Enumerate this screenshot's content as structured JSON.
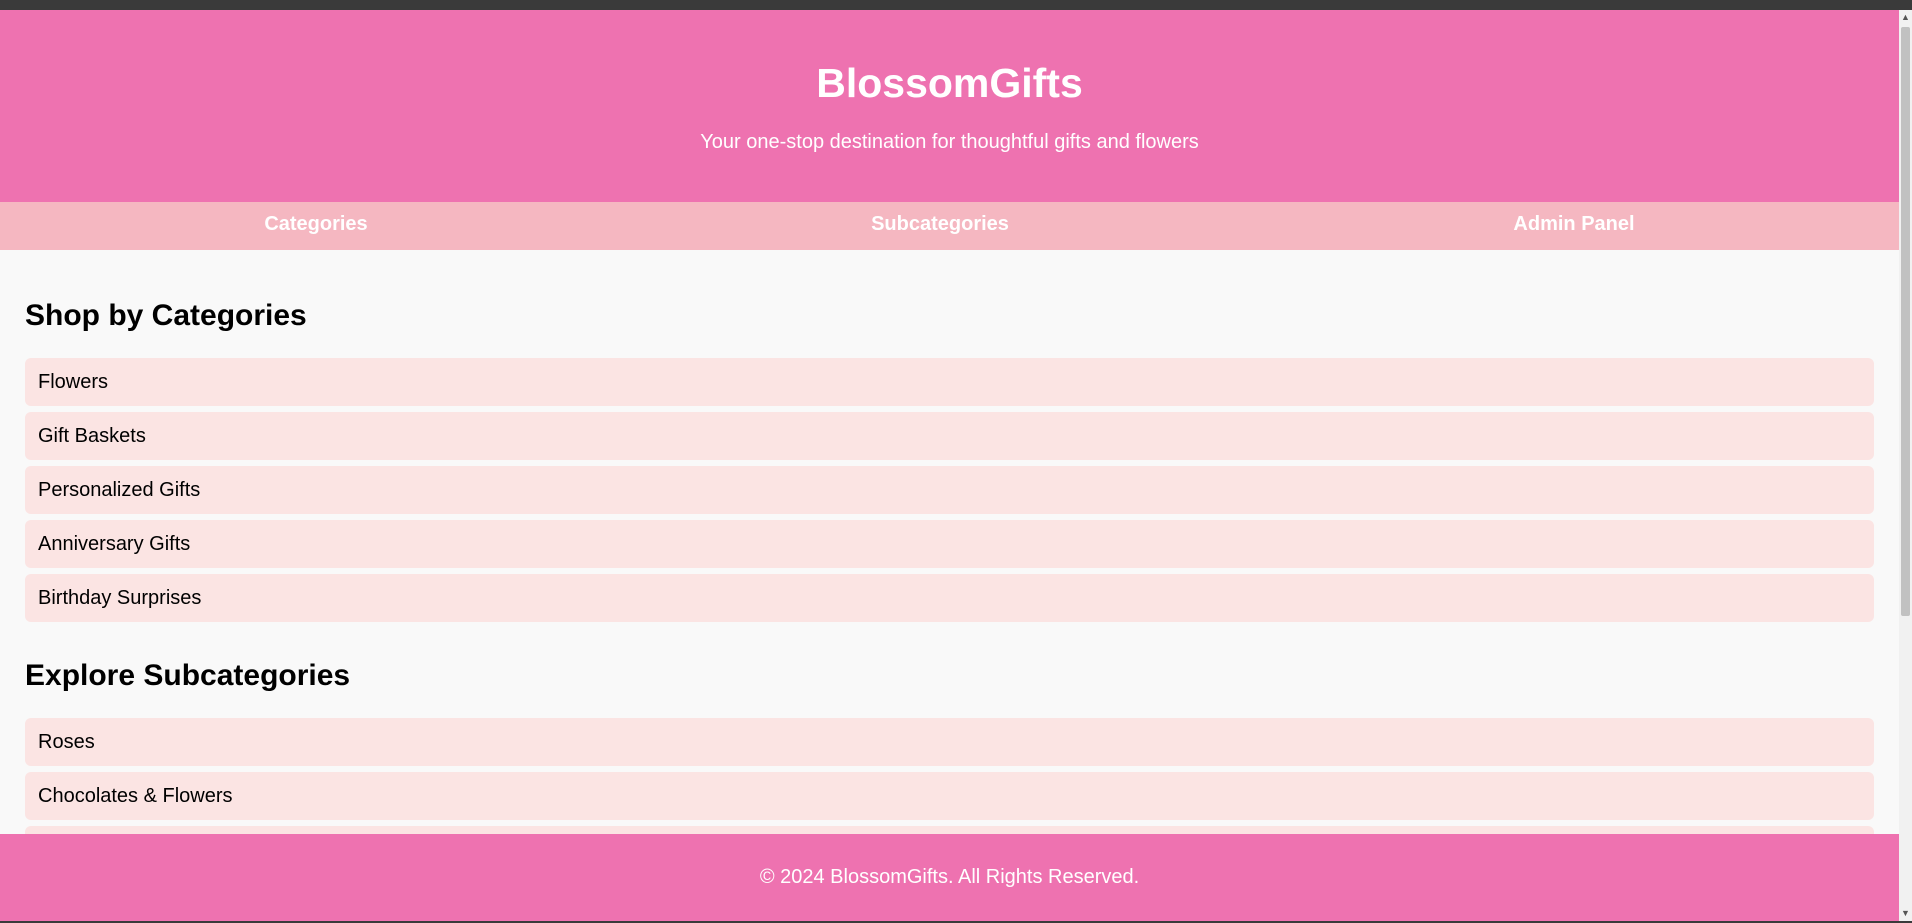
{
  "header": {
    "title": "BlossomGifts",
    "tagline": "Your one-stop destination for thoughtful gifts and flowers"
  },
  "nav": {
    "items": [
      {
        "label": "Categories"
      },
      {
        "label": "Subcategories"
      },
      {
        "label": "Admin Panel"
      }
    ]
  },
  "categories": {
    "heading": "Shop by Categories",
    "items": [
      {
        "label": "Flowers"
      },
      {
        "label": "Gift Baskets"
      },
      {
        "label": "Personalized Gifts"
      },
      {
        "label": "Anniversary Gifts"
      },
      {
        "label": "Birthday Surprises"
      }
    ]
  },
  "subcategories": {
    "heading": "Explore Subcategories",
    "items": [
      {
        "label": "Roses"
      },
      {
        "label": "Chocolates & Flowers"
      },
      {
        "label": ""
      }
    ]
  },
  "footer": {
    "text": "© 2024 BlossomGifts. All Rights Reserved."
  },
  "colors": {
    "brand_pink": "#ee72b0",
    "nav_pink": "#f5b7c1",
    "item_bg": "#fbe4e3",
    "page_bg": "#f9f9f9"
  },
  "icons": {
    "scroll_up": "triangle-up",
    "scroll_down": "triangle-down"
  }
}
